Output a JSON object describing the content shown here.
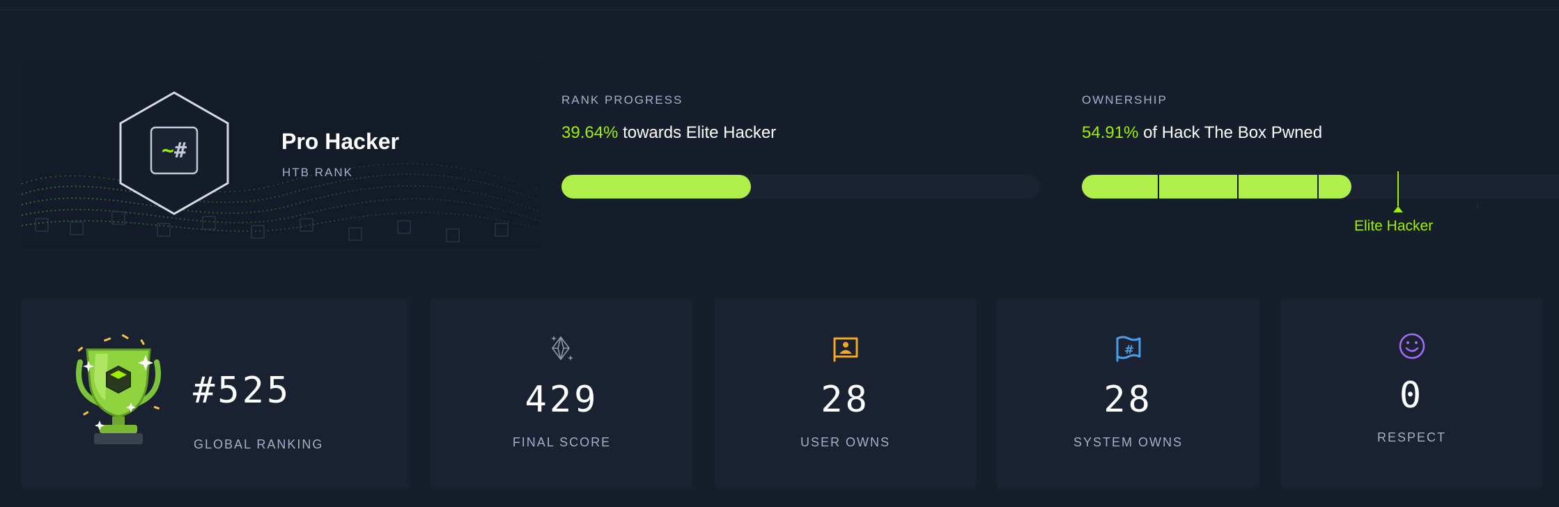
{
  "rank": {
    "title": "Pro Hacker",
    "subtitle": "HTB RANK",
    "logo_glyph": "~#"
  },
  "rank_progress": {
    "label": "RANK PROGRESS",
    "percent_text": "39.64%",
    "towards_word": "towards",
    "target": "Elite Hacker",
    "fill_fraction": 0.3964
  },
  "ownership": {
    "label": "OWNERSHIP",
    "percent_text": "54.91%",
    "suffix": "of Hack The Box Pwned",
    "marker_label": "Elite Hacker",
    "fill_fraction": 0.5491
  },
  "stats": {
    "global_ranking": {
      "value": "#525",
      "label": "GLOBAL RANKING",
      "icon": "trophy-icon"
    },
    "final_score": {
      "value": "429",
      "label": "FINAL SCORE",
      "icon": "diamond-icon"
    },
    "user_owns": {
      "value": "28",
      "label": "USER OWNS",
      "icon": "user-flag-icon"
    },
    "system_owns": {
      "value": "28",
      "label": "SYSTEM OWNS",
      "icon": "system-flag-icon"
    },
    "respect": {
      "value": "0",
      "label": "RESPECT",
      "icon": "smiley-icon"
    }
  },
  "colors": {
    "background": "#161d2b",
    "card": "#1a2130",
    "accent_green": "#9fef00",
    "bar_green": "#b0ef4a",
    "user_owns_orange": "#f5a623",
    "system_owns_blue": "#4a9fe8",
    "respect_purple": "#a36cf7",
    "label_gray": "#a4b1cd"
  }
}
